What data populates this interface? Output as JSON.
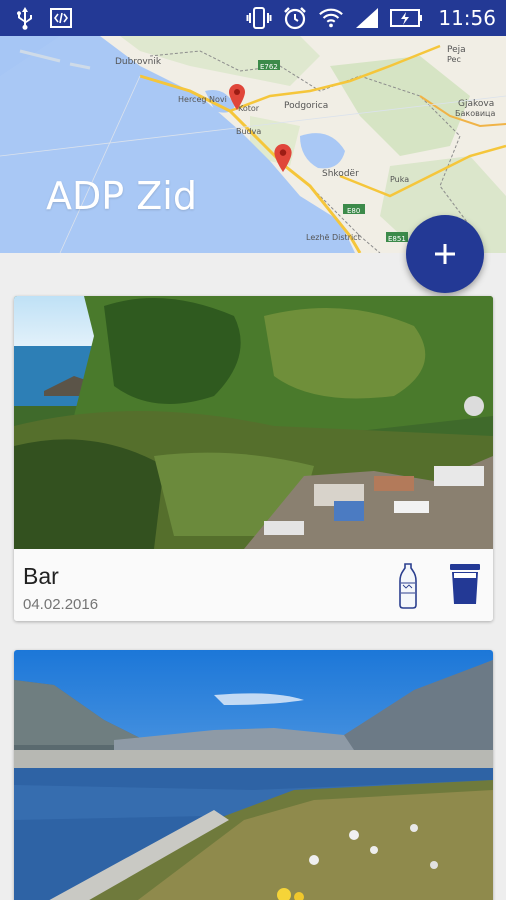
{
  "status_bar": {
    "time": "11:56",
    "icons": [
      "usb-icon",
      "code-icon",
      "vibrate-icon",
      "alarm-icon",
      "wifi-icon",
      "signal-icon",
      "battery-icon"
    ]
  },
  "header": {
    "title": "ADP Zid",
    "map_labels": [
      "Dubrovnik",
      "Herceg Novi",
      "Kotor",
      "Podgorica",
      "Budva",
      "Shkodër",
      "Peja",
      "Pec",
      "Gjakova",
      "Бaкoвицa",
      "Puka",
      "Lezhë District",
      "E762",
      "E80",
      "E851"
    ]
  },
  "fab": {
    "icon": "plus-icon"
  },
  "cards": [
    {
      "title": "Bar",
      "date": "04.02.2016",
      "icons": [
        "bottle-icon",
        "trash-bin-icon"
      ]
    },
    {
      "title": "",
      "date": ""
    }
  ],
  "colors": {
    "primary": "#233995",
    "background": "#eeeeee",
    "card": "#fafafa"
  }
}
